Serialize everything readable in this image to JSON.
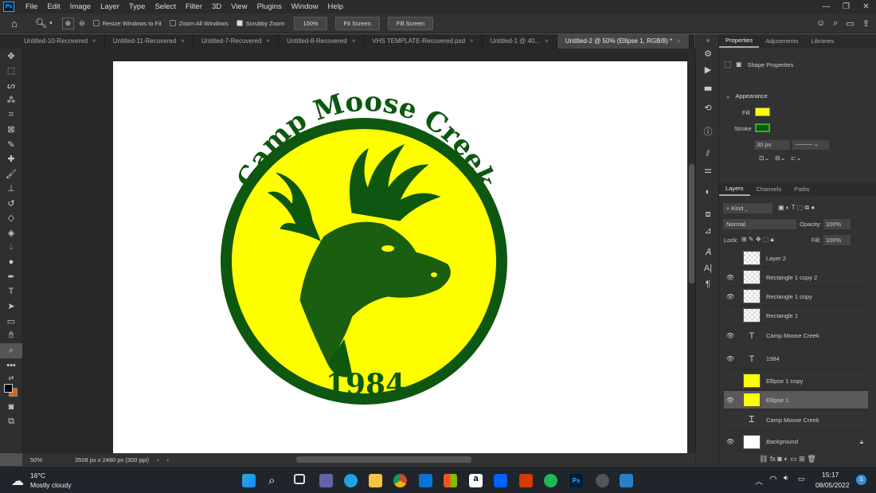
{
  "menubar": {
    "app_icon": "Ps",
    "items": [
      "File",
      "Edit",
      "Image",
      "Layer",
      "Type",
      "Select",
      "Filter",
      "3D",
      "View",
      "Plugins",
      "Window",
      "Help"
    ]
  },
  "options": {
    "resize_windows": "Resize Windows to Fit",
    "zoom_all": "Zoom All Windows",
    "scrubby_zoom": "Scrubby Zoom",
    "zoom_value": "100%",
    "fit_screen": "Fit Screen",
    "fill_screen": "Fill Screen"
  },
  "tabs": [
    "Untitled-10-Recovered",
    "Untitled-11-Recovered",
    "Untitled-7-Recovered",
    "Untitled-8-Recovered",
    "VHS TEMPLATE-Recovered.psd",
    "Untitled-1 @ 40...",
    "Untitled-2 @ 50% (Ellipse 1, RGB/8) *"
  ],
  "artwork": {
    "title_text": "Camp Moose Creek",
    "year_text": "1984",
    "fill_color": "#ffff00",
    "ring_color": "#0d5710"
  },
  "status": {
    "zoom": "50%",
    "doc_info": "3508 px x 2480 px (300 ppi)"
  },
  "properties": {
    "tabs": [
      "Properties",
      "Adjustments",
      "Libraries"
    ],
    "subtitle": "Shape Properties",
    "appearance": "Appearance",
    "fill_label": "Fill",
    "stroke_label": "Stroke",
    "stroke_width": "30 px"
  },
  "layers_panel": {
    "tabs": [
      "Layers",
      "Channels",
      "Paths"
    ],
    "kind": "Kind",
    "blend_mode": "Normal",
    "opacity_label": "Opacity:",
    "opacity": "100%",
    "lock_label": "Lock:",
    "fill_label": "Fill:",
    "fill": "100%",
    "layers": [
      {
        "name": "Layer 2"
      },
      {
        "name": "Rectangle 1 copy 2"
      },
      {
        "name": "Rectangle 1 copy"
      },
      {
        "name": "Rectangle 1"
      },
      {
        "name": "Camp Moose Creek"
      },
      {
        "name": "1984"
      },
      {
        "name": "Ellipse 1 copy"
      },
      {
        "name": "Ellipse 1"
      },
      {
        "name": "Camp Moose Creek"
      },
      {
        "name": "Background"
      }
    ]
  },
  "taskbar": {
    "temp": "16°C",
    "weather": "Mostly cloudy",
    "time": "15:17",
    "date": "08/05/2022"
  }
}
